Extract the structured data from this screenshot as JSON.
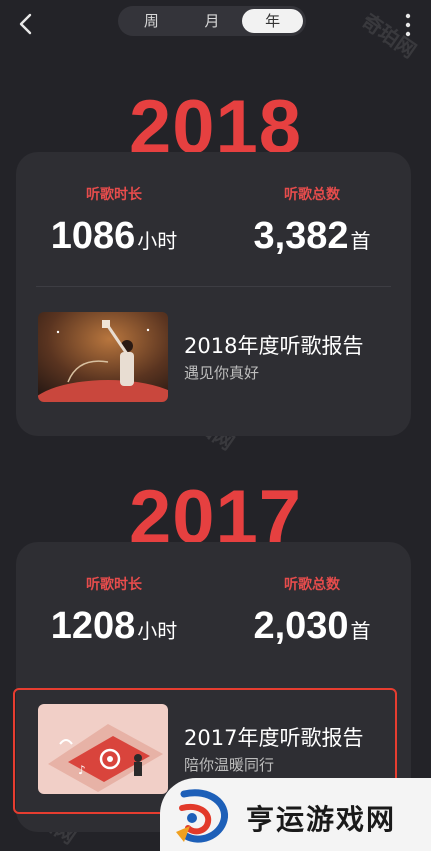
{
  "header": {
    "tabs": [
      {
        "label": "周",
        "active": false
      },
      {
        "label": "月",
        "active": false
      },
      {
        "label": "年",
        "active": true
      }
    ]
  },
  "watermark": "奇珀网",
  "years": [
    {
      "year": "2018",
      "duration_label": "听歌时长",
      "duration_value": "1086",
      "duration_unit": "小时",
      "count_label": "听歌总数",
      "count_value": "3,382",
      "count_unit": "首",
      "report_title": "2018年度听歌报告",
      "report_subtitle": "遇见你真好"
    },
    {
      "year": "2017",
      "duration_label": "听歌时长",
      "duration_value": "1208",
      "duration_unit": "小时",
      "count_label": "听歌总数",
      "count_value": "2,030",
      "count_unit": "首",
      "report_title": "2017年度听歌报告",
      "report_subtitle": "陪你温暖同行"
    }
  ],
  "brand": {
    "name": "亨运游戏网"
  },
  "colors": {
    "accent": "#e64040",
    "background": "#232328",
    "card": "#2e2e33",
    "highlight": "#e63d30"
  }
}
